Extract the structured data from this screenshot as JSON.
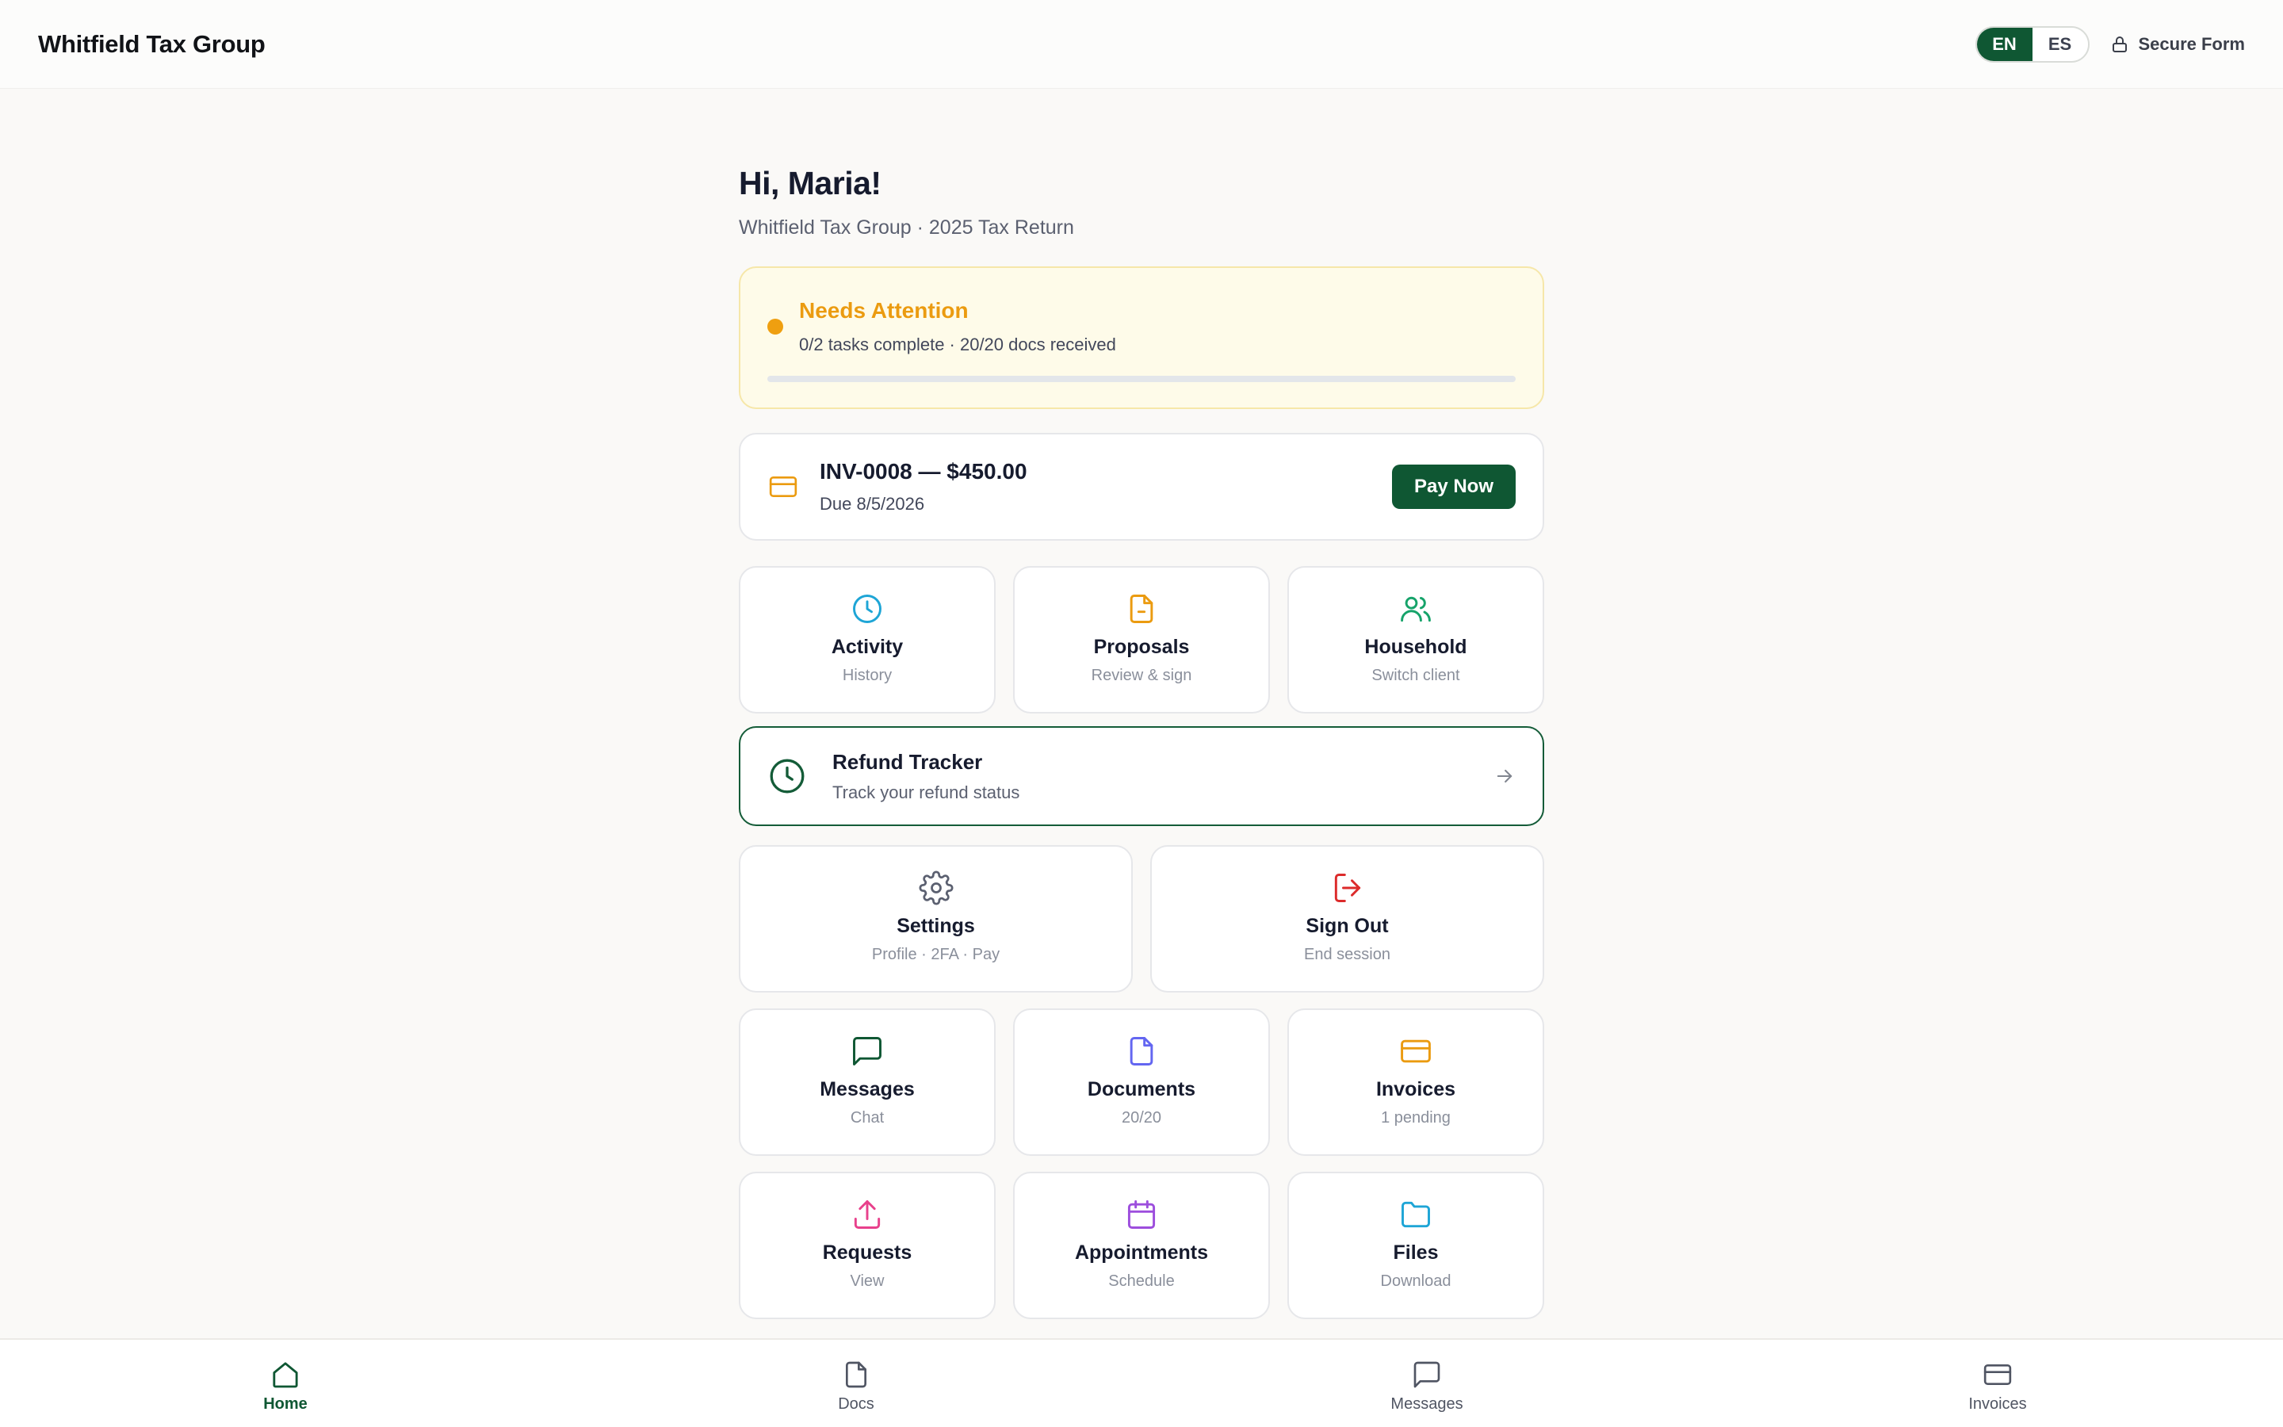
{
  "header": {
    "brand": "Whitfield Tax Group",
    "lang_en": "EN",
    "lang_es": "ES",
    "secure_label": "Secure Form"
  },
  "greeting": {
    "title": "Hi, Maria!",
    "subtitle": "Whitfield Tax Group · 2025 Tax Return"
  },
  "attention": {
    "title": "Needs Attention",
    "meta": "0/2 tasks complete · 20/20 docs received",
    "progress_fraction": 0.0,
    "accent_color": "#eb9b10"
  },
  "invoice": {
    "icon": "credit-card-icon",
    "title": "INV-0008 — $450.00",
    "due": "Due 8/5/2026",
    "pay_label": "Pay Now"
  },
  "tiles_row1": [
    {
      "label": "Activity",
      "sub": "History",
      "icon": "clock-icon",
      "color": "#1ea5d6"
    },
    {
      "label": "Proposals",
      "sub": "Review & sign",
      "icon": "document-icon",
      "color": "#eb9b10"
    },
    {
      "label": "Household",
      "sub": "Switch client",
      "icon": "users-icon",
      "color": "#16a36a"
    }
  ],
  "refund": {
    "title": "Refund Tracker",
    "sub": "Track your refund status",
    "icon": "clock-icon"
  },
  "tiles_row2": [
    {
      "label": "Settings",
      "sub": "Profile · 2FA · Pay",
      "icon": "gear-icon",
      "color": "#5b6070"
    },
    {
      "label": "Sign Out",
      "sub": "End session",
      "icon": "sign-out-icon",
      "color": "#dc2b2b"
    }
  ],
  "tiles_row3": [
    {
      "label": "Messages",
      "sub": "Chat",
      "icon": "chat-icon",
      "color": "#0f5733"
    },
    {
      "label": "Documents",
      "sub": "20/20",
      "icon": "document-icon",
      "color": "#6366f1"
    },
    {
      "label": "Invoices",
      "sub": "1 pending",
      "icon": "credit-card-icon",
      "color": "#eb9b10"
    }
  ],
  "tiles_row4": [
    {
      "label": "Requests",
      "sub": "View",
      "icon": "upload-icon",
      "color": "#e8418c"
    },
    {
      "label": "Appointments",
      "sub": "Schedule",
      "icon": "calendar-icon",
      "color": "#9d4edd"
    },
    {
      "label": "Files",
      "sub": "Download",
      "icon": "folder-icon",
      "color": "#1ea5d6"
    }
  ],
  "nav": [
    {
      "label": "Home",
      "icon": "home-icon",
      "active": true
    },
    {
      "label": "Docs",
      "icon": "document-icon",
      "active": false
    },
    {
      "label": "Messages",
      "icon": "chat-icon",
      "active": false
    },
    {
      "label": "Invoices",
      "icon": "credit-card-icon",
      "active": false
    }
  ]
}
